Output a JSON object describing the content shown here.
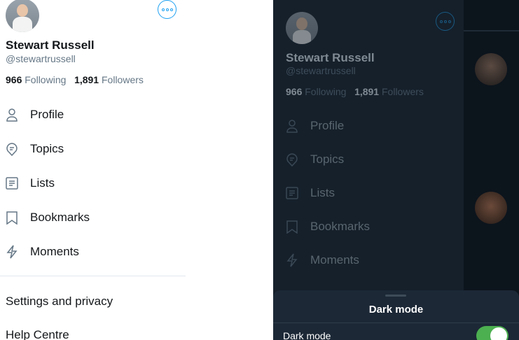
{
  "profile": {
    "name": "Stewart Russell",
    "handle": "@stewartrussell",
    "following_count": "966",
    "following_label": "Following",
    "followers_count": "1,891",
    "followers_label": "Followers"
  },
  "menu": {
    "items": [
      {
        "label": "Profile",
        "icon": "person-icon"
      },
      {
        "label": "Topics",
        "icon": "topics-icon"
      },
      {
        "label": "Lists",
        "icon": "lists-icon"
      },
      {
        "label": "Bookmarks",
        "icon": "bookmark-icon"
      },
      {
        "label": "Moments",
        "icon": "lightning-icon"
      }
    ],
    "settings_label": "Settings and privacy",
    "help_label": "Help Centre"
  },
  "dark_sheet": {
    "title": "Dark mode",
    "row_label": "Dark mode",
    "toggle_on": true
  },
  "colors": {
    "accent": "#1da1f2",
    "dark_bg": "#15202b",
    "toggle_on": "#4caf50"
  }
}
